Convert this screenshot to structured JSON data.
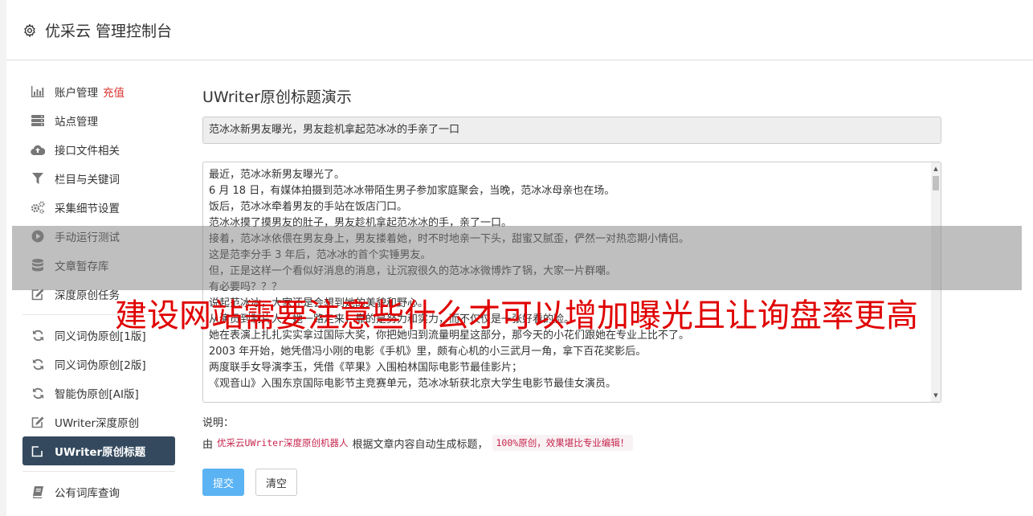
{
  "header": {
    "title": "优采云 管理控制台",
    "icon": "gear-icon"
  },
  "sidebar": {
    "group1": [
      {
        "label": "账户管理",
        "badge": "充值",
        "icon": "bar-chart-icon"
      },
      {
        "label": "站点管理",
        "icon": "server-icon"
      },
      {
        "label": "接口文件相关",
        "icon": "cloud-upload-icon"
      },
      {
        "label": "栏目与关键词",
        "icon": "filter-icon"
      },
      {
        "label": "采集细节设置",
        "icon": "gears-icon"
      },
      {
        "label": "手动运行测试",
        "icon": "play-circle-icon"
      },
      {
        "label": "文章暂存库",
        "icon": "database-icon"
      },
      {
        "label": "深度原创任务",
        "icon": "edit-icon"
      }
    ],
    "group2": [
      {
        "label": "同义词伪原创[1版]",
        "icon": "refresh-icon"
      },
      {
        "label": "同义词伪原创[2版]",
        "icon": "refresh-icon"
      },
      {
        "label": "智能伪原创[AI版]",
        "icon": "refresh-icon"
      },
      {
        "label": "UWriter深度原创",
        "icon": "edit-icon"
      },
      {
        "label": "UWriter原创标题",
        "icon": "edit-icon",
        "active": true
      }
    ],
    "group3": [
      {
        "label": "公有词库查询",
        "icon": "book-icon"
      }
    ]
  },
  "main": {
    "page_title": "UWriter原创标题演示",
    "title_value": "范冰冰新男友曝光，男友趁机拿起范冰冰的手亲了一口",
    "article_lines": [
      "最近，范冰冰新男友曝光了。",
      "6 月 18 日，有媒体拍摄到范冰冰带陌生男子参加家庭聚会，当晚，范冰冰母亲也在场。",
      "饭后，范冰冰牵着男友的手站在饭店门口。",
      "范冰冰摸了摸男友的肚子，男友趁机拿起范冰冰的手，亲了一口。",
      "接着，范冰冰依偎在男友身上，男友搂着她，时不时地亲一下头，甜蜜又腻歪，俨然一对热恋期小情侣。",
      "这是范李分手 3 年后，范冰冰的首个实锤男友。",
      "但，正是这样一个看似好消息的消息，让沉寂很久的范冰冰微博炸了锅，大家一片群嘲。",
      "有必要吗？？？",
      "说起范冰冰，大家还是会想到她的美貌和野心。",
      "从演员到制片人，她一路走来，靠的是努力和实力，而不仅仅是一张好看的脸。",
      "她在表演上扎扎实实拿过国际大奖，你把她归到流量明星这部分，那今天的小花们跟她在专业上比不了。",
      "2003 年开始，她凭借冯小刚的电影《手机》里，颇有心机的小三武月一角，拿下百花奖影后。",
      "两度联手女导演李玉，凭借《苹果》入围柏林国际电影节最佳影片；",
      "《观音山》入围东京国际电影节主竞赛单元，范冰冰斩获北京大学生电影节最佳女演员。"
    ],
    "note_label": "说明：",
    "note_prefix": "由",
    "note_highlight": "优采云UWriter深度原创机器人",
    "note_middle": "根据文章内容自动生成标题，",
    "note_code": "100%原创，效果堪比专业编辑！",
    "submit_label": "提交",
    "clear_label": "清空"
  },
  "watermark": "建设网站需要注意些什么才可以增加曝光且让询盘率更高"
}
